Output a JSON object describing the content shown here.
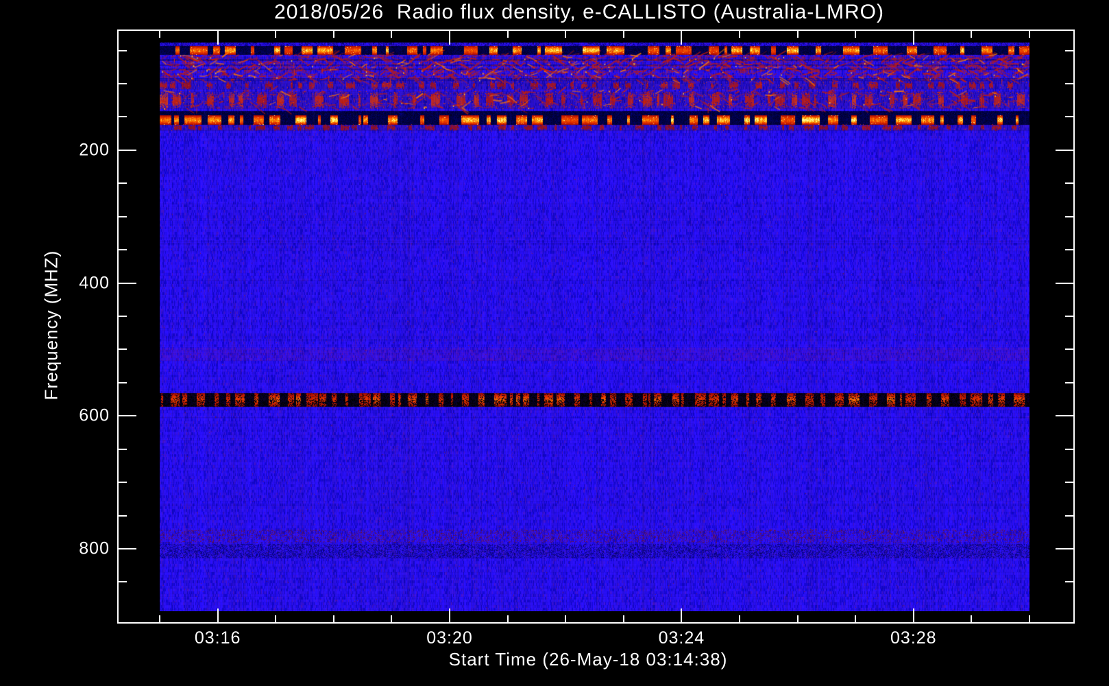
{
  "chart_data": {
    "type": "heatmap",
    "title": "2018/05/26  Radio flux density, e-CALLISTO (Australia-LMRO)",
    "xlabel": "Start Time (26-May-18 03:14:38)",
    "ylabel": "Frequency (MHZ)",
    "x_axis": {
      "start_minute": 15,
      "end_minute": 30,
      "major_ticks": [
        {
          "label": "03:16",
          "minute": 16
        },
        {
          "label": "03:20",
          "minute": 20
        },
        {
          "label": "03:24",
          "minute": 24
        },
        {
          "label": "03:28",
          "minute": 28
        }
      ],
      "minor_tick_every_min": 1
    },
    "y_axis": {
      "range_mhz": [
        38,
        894
      ],
      "major_ticks": [
        {
          "label": "200",
          "mhz": 200
        },
        {
          "label": "400",
          "mhz": 400
        },
        {
          "label": "600",
          "mhz": 600
        },
        {
          "label": "800",
          "mhz": 800
        }
      ],
      "minor_tick_step_mhz": 50,
      "minor_tick_min_mhz": 50,
      "minor_tick_max_mhz": 850
    },
    "colormap": {
      "base_blue": "#2a16f0",
      "dark_blue": "#1408c8",
      "navy": "#000060",
      "red": "#d21800",
      "orange": "#ff7800",
      "yellow": "#ffd23c",
      "dark_red": "#7a1408",
      "black": "#000000",
      "frame": "#ffffff",
      "background": "#000000"
    },
    "rfi_bands": [
      {
        "name": "top-edge-mottle",
        "f_lo": 38,
        "f_hi": 43,
        "style": "navy-mottle",
        "level": 0.55
      },
      {
        "name": "dash-band-50mhz",
        "f_lo": 43,
        "f_hi": 56,
        "style": "bright-dash",
        "level": 0.9
      },
      {
        "name": "active-60-95mhz",
        "f_lo": 56,
        "f_hi": 96,
        "style": "active",
        "level": 0.85
      },
      {
        "name": "speckle-100mhz",
        "f_lo": 96,
        "f_hi": 108,
        "style": "med-dash",
        "level": 0.45
      },
      {
        "name": "dash-band-125mhz",
        "f_lo": 111,
        "f_hi": 137,
        "style": "med-dash",
        "level": 0.75
      },
      {
        "name": "navy-line-145mhz",
        "f_lo": 141,
        "f_hi": 147,
        "style": "dark-row",
        "level": 0.8
      },
      {
        "name": "dash-band-155mhz",
        "f_lo": 147,
        "f_hi": 161,
        "style": "bright-dash",
        "level": 1.0
      },
      {
        "name": "fade-165mhz",
        "f_lo": 161,
        "f_hi": 170,
        "style": "med-dash",
        "level": 0.3
      },
      {
        "name": "faint-505mhz",
        "f_lo": 498,
        "f_hi": 516,
        "style": "faint-mottle",
        "level": 0.6
      },
      {
        "name": "dark-dash-575mhz",
        "f_lo": 566,
        "f_hi": 585,
        "style": "dark-dash",
        "level": 1.0
      },
      {
        "name": "faint-red-780mhz",
        "f_lo": 771,
        "f_hi": 790,
        "style": "faint-red",
        "level": 0.65
      },
      {
        "name": "navy-mottle-800mhz",
        "f_lo": 793,
        "f_hi": 813,
        "style": "navy-mottle",
        "level": 0.8
      }
    ],
    "squiggle_zones": [
      {
        "f_lo": 57,
        "f_hi": 95,
        "count": 1300
      },
      {
        "f_lo": 110,
        "f_hi": 137,
        "count": 360
      }
    ]
  }
}
